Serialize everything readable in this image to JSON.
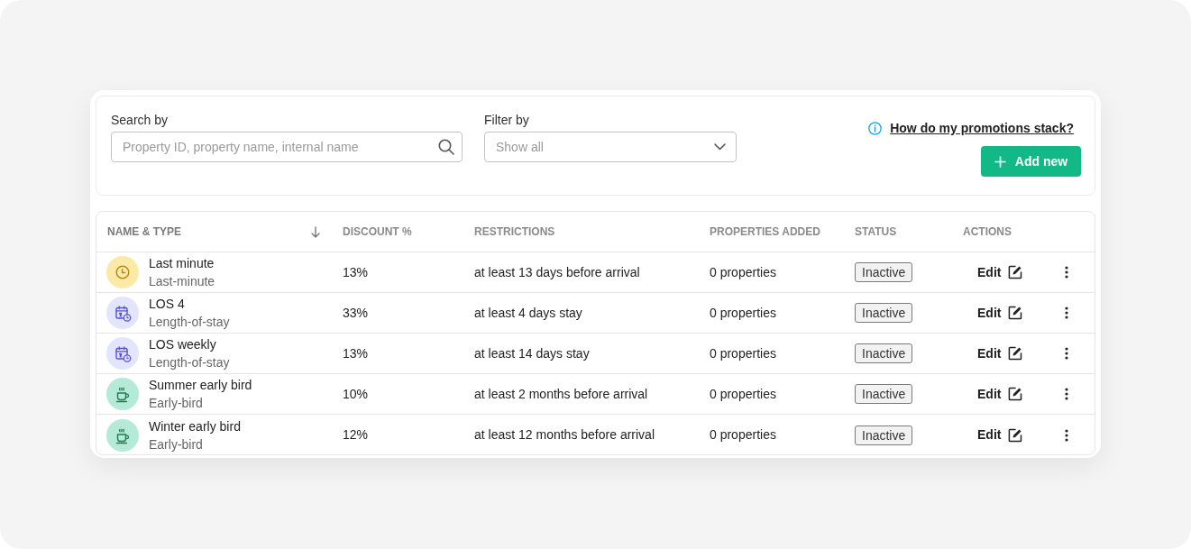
{
  "search": {
    "label": "Search by",
    "placeholder": "Property ID, property name, internal name"
  },
  "filter": {
    "label": "Filter by",
    "placeholder": "Show all"
  },
  "help_link": {
    "text": "How do my promotions stack?"
  },
  "add_button": {
    "label": "Add new"
  },
  "table": {
    "columns": [
      {
        "label": "NAME & TYPE",
        "sorted": true
      },
      {
        "label": "DISCOUNT %",
        "sorted": false
      },
      {
        "label": "RESTRICTIONS",
        "sorted": false
      },
      {
        "label": "PROPERTIES ADDED",
        "sorted": false
      },
      {
        "label": "STATUS",
        "sorted": false
      },
      {
        "label": "ACTIONS",
        "sorted": false
      }
    ],
    "rows": [
      {
        "kind": "clock",
        "name": "Last minute",
        "type": "Last-minute",
        "discount": "13%",
        "restrictions": "at least 13 days before arrival",
        "properties": "0 properties",
        "status": "Inactive",
        "action": "Edit"
      },
      {
        "kind": "calendar",
        "name": "LOS 4",
        "type": "Length-of-stay",
        "discount": "33%",
        "restrictions": "at least 4 days stay",
        "properties": "0 properties",
        "status": "Inactive",
        "action": "Edit"
      },
      {
        "kind": "calendar",
        "name": "LOS weekly",
        "type": "Length-of-stay",
        "discount": "13%",
        "restrictions": "at least 14 days stay",
        "properties": "0 properties",
        "status": "Inactive",
        "action": "Edit"
      },
      {
        "kind": "cup",
        "name": "Summer early bird",
        "type": "Early-bird",
        "discount": "10%",
        "restrictions": "at least 2 months before arrival",
        "properties": "0 properties",
        "status": "Inactive",
        "action": "Edit"
      },
      {
        "kind": "cup",
        "name": "Winter early bird",
        "type": "Early-bird",
        "discount": "12%",
        "restrictions": "at least 12 months before arrival",
        "properties": "0 properties",
        "status": "Inactive",
        "action": "Edit"
      }
    ]
  }
}
